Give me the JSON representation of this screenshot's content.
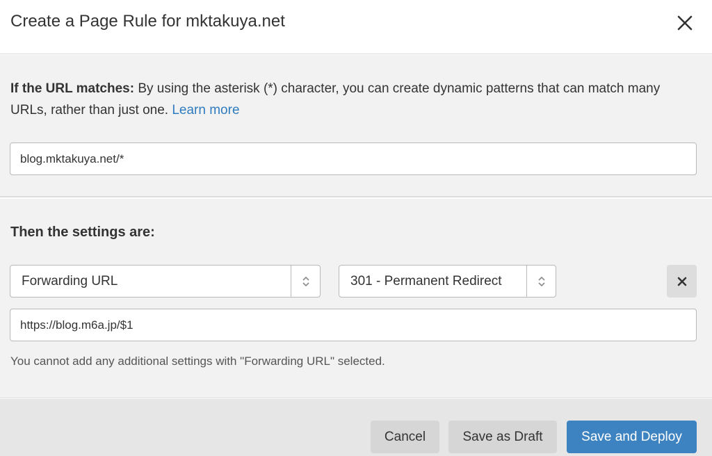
{
  "dialog": {
    "title": "Create a Page Rule for mktakuya.net",
    "close_icon": "close-icon"
  },
  "url_match": {
    "label_bold": "If the URL matches:",
    "description": " By using the asterisk (*) character, you can create dynamic patterns that can match many URLs, rather than just one. ",
    "learn_more": "Learn more",
    "input_value": "blog.mktakuya.net/*"
  },
  "settings": {
    "heading": "Then the settings are:",
    "setting_select": {
      "value": "Forwarding URL",
      "icon": "select-arrows-icon"
    },
    "status_select": {
      "value": "301 - Permanent Redirect",
      "icon": "select-arrows-icon"
    },
    "remove_icon": "close-icon",
    "destination_value": "https://blog.m6a.jp/$1",
    "hint": "You cannot add any additional settings with \"Forwarding URL\" selected."
  },
  "footer": {
    "cancel_label": "Cancel",
    "draft_label": "Save as Draft",
    "deploy_label": "Save and Deploy"
  },
  "colors": {
    "link": "#2f7bbf",
    "primary_button": "#3d83c1",
    "panel_background": "#f2f2f2",
    "footer_background": "#e6e6e6"
  }
}
